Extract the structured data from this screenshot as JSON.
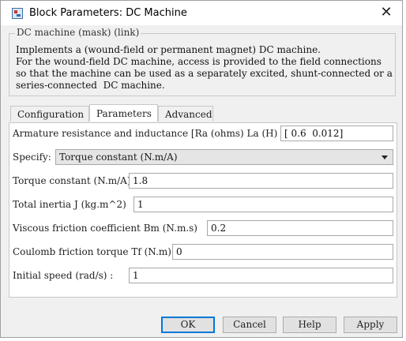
{
  "window": {
    "title": "Block Parameters: DC Machine",
    "close_glyph": "✕"
  },
  "mask": {
    "legend": "DC machine (mask) (link)",
    "description": "Implements a (wound-field or permanent magnet) DC machine.\nFor the wound-field DC machine, access is provided to the field connections\nso that the machine can be used as a separately excited, shunt-connected or a\nseries-connected  DC machine."
  },
  "tabs": [
    {
      "label": "Configuration",
      "active": false
    },
    {
      "label": "Parameters",
      "active": true
    },
    {
      "label": "Advanced",
      "active": false
    }
  ],
  "params": {
    "armature_label": "Armature resistance and inductance [Ra (ohms) La (H) ]",
    "armature_value": "[ 0.6  0.012]",
    "specify_label": "Specify:",
    "specify_value": "Torque constant (N.m/A)",
    "torque_label": "Torque constant (N.m/A)",
    "torque_value": "1.8",
    "inertia_label": "Total inertia J (kg.m^2)",
    "inertia_value": "1",
    "viscous_label": "Viscous friction coefficient Bm (N.m.s)",
    "viscous_value": "0.2",
    "coulomb_label": "Coulomb friction torque Tf (N.m)",
    "coulomb_value": "0",
    "speed_label": "Initial speed (rad/s) :",
    "speed_value": "1"
  },
  "buttons": {
    "ok": "OK",
    "cancel": "Cancel",
    "help": "Help",
    "apply": "Apply"
  },
  "colors": {
    "dialog_bg": "#f0f0f0",
    "panel_bg": "#ffffff",
    "default_button_border": "#0078d7"
  }
}
